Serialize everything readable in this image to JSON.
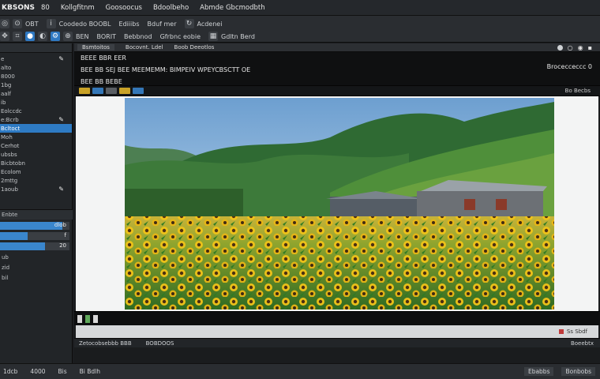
{
  "menubar": {
    "app_name": "KBSONS",
    "items": [
      "80",
      "Kollgfitnm",
      "Goosoocus",
      "Bdoolbeho",
      "Abmde Gbcmodbth"
    ]
  },
  "toolbar": {
    "row1": [
      "OBT",
      "Coodedo BOOBL",
      "Ediiibs",
      "Bduf mer",
      "Acdenei"
    ],
    "row2": [
      "BEN",
      "BORIT",
      "Bebbnod",
      "Gfrbnc eobie",
      "Gdltn Berd"
    ]
  },
  "left_panel": {
    "items": [
      {
        "label": "e",
        "icon": "pencil-icon"
      },
      {
        "label": "alto",
        "icon": ""
      },
      {
        "label": "8000",
        "icon": ""
      },
      {
        "label": "1bg",
        "icon": ""
      },
      {
        "label": "aalf",
        "icon": ""
      },
      {
        "label": "ib",
        "icon": ""
      },
      {
        "label": "Eolccdc",
        "icon": ""
      },
      {
        "label": "e:Bcrb",
        "icon": "pencil-icon"
      },
      {
        "label": "Bcltoct",
        "icon": "",
        "selected": true
      },
      {
        "label": "Moh",
        "icon": ""
      },
      {
        "label": "Cerhot",
        "icon": ""
      },
      {
        "label": "ubsbs",
        "icon": ""
      },
      {
        "label": "Bicbtobn",
        "icon": ""
      },
      {
        "label": "Ecolom",
        "icon": ""
      },
      {
        "label": "2mttg",
        "icon": ""
      },
      {
        "label": "1aoub",
        "icon": "pencil-icon"
      }
    ],
    "section_title": "Enbte",
    "bars": [
      {
        "label": "dlob",
        "fill": 0.9
      },
      {
        "label": "f",
        "fill": 0.4
      },
      {
        "label": "20",
        "fill": 0.65
      }
    ],
    "small_items": [
      "ub",
      "zid",
      "bil"
    ]
  },
  "main": {
    "tabs": [
      "Bsmtoitos",
      "Bocovnt. Ldel",
      "Boob Deeotlos"
    ],
    "header_line1": "BEEE BBR EER",
    "header_line2": "BEE BB SEJ BEE MEEMEMM: BIMPEIV WPEYCBSCTT OE",
    "header_line3": "BEE BB BEBE",
    "header_right": "Brocecceccc 0",
    "subbar_right": "Bo Becbs",
    "status_text": "Ss Sbdf",
    "bottom_left": "Zetocobsebbb BBB",
    "bottom_mid": "BOBDOOS",
    "bottom_right": "Boeebtx"
  },
  "statusbar": {
    "items": [
      "1dcb",
      "4000",
      "Bis",
      "Bi Bdlh"
    ],
    "right": [
      "Ebabbs",
      "Bonbobs"
    ]
  },
  "colors": {
    "accent": "#2e7bc4",
    "panel_bg": "#222528",
    "header_bg": "#0f1011"
  }
}
